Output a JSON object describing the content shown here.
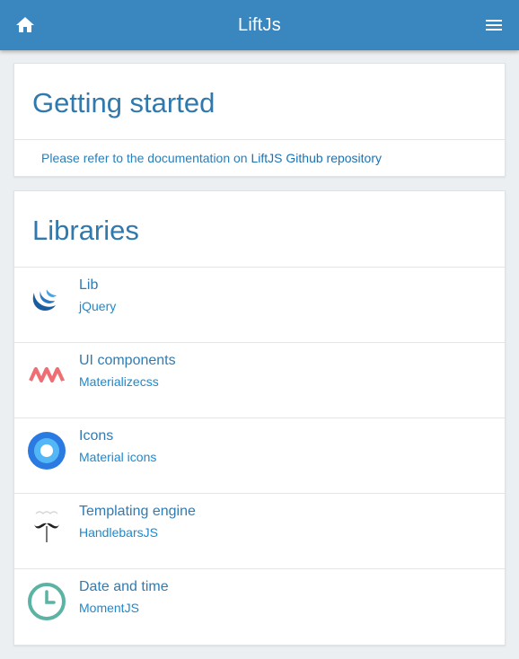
{
  "app": {
    "title": "LiftJs"
  },
  "getting_started": {
    "title": "Getting started",
    "text_prefix": "Please refer to the documentation on ",
    "link_text": "LiftJS Github repository"
  },
  "libraries": {
    "title": "Libraries",
    "items": [
      {
        "title": "Lib",
        "subtitle": "jQuery",
        "icon": "jquery-icon"
      },
      {
        "title": "UI components",
        "subtitle": "Materializecss",
        "icon": "materialize-icon"
      },
      {
        "title": "Icons",
        "subtitle": "Material icons",
        "icon": "material-icons-icon"
      },
      {
        "title": "Templating engine",
        "subtitle": "HandlebarsJS",
        "icon": "handlebars-icon"
      },
      {
        "title": "Date and time",
        "subtitle": "MomentJS",
        "icon": "moment-icon"
      }
    ]
  },
  "colors": {
    "header": "#3a86bf",
    "accent_text": "#3178ad",
    "link": "#1a8ad0"
  }
}
